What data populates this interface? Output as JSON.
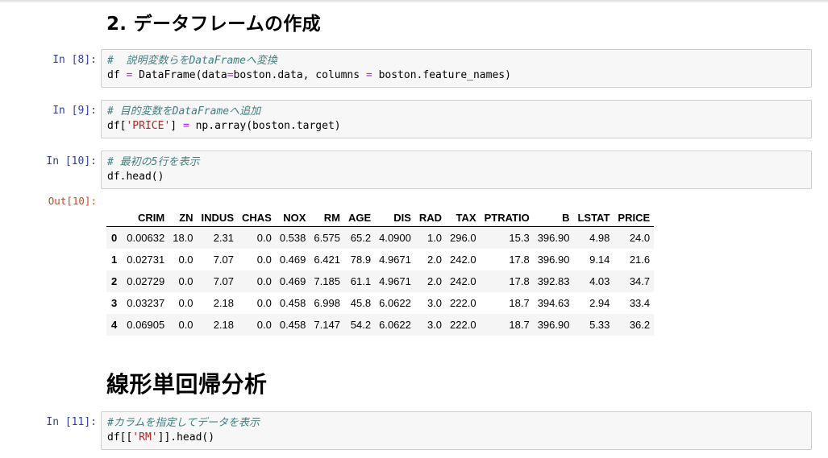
{
  "section_titles": {
    "create_dataframe": "2. データフレームの作成",
    "linear_regression": "線形単回帰分析"
  },
  "cells": [
    {
      "prompt": "In [8]:",
      "comment": "#  説明変数らをDataFrameへ変換",
      "code_a": "df ",
      "code_op": "=",
      "code_b": " DataFrame(data",
      "code_op2": "=",
      "code_c": "boston.data, columns ",
      "code_op3": "=",
      "code_d": " boston.feature_names)"
    },
    {
      "prompt": "In [9]:",
      "comment": "# 目的変数をDataFrameへ追加",
      "code_a": "df[",
      "code_str": "'PRICE'",
      "code_b": "] ",
      "code_op": "=",
      "code_c": " np.array(boston.target)"
    },
    {
      "prompt": "In [10]:",
      "comment": "# 最初の5行を表示",
      "code": "df.head()"
    },
    {
      "prompt": "In [11]:",
      "comment": "#カラムを指定してデータを表示",
      "code_a": "df[[",
      "code_str": "'RM'",
      "code_b": "]].head()"
    }
  ],
  "output": {
    "prompt": "Out[10]:",
    "columns": [
      "CRIM",
      "ZN",
      "INDUS",
      "CHAS",
      "NOX",
      "RM",
      "AGE",
      "DIS",
      "RAD",
      "TAX",
      "PTRATIO",
      "B",
      "LSTAT",
      "PRICE"
    ],
    "rows": [
      {
        "index": "0",
        "values": [
          "0.00632",
          "18.0",
          "2.31",
          "0.0",
          "0.538",
          "6.575",
          "65.2",
          "4.0900",
          "1.0",
          "296.0",
          "15.3",
          "396.90",
          "4.98",
          "24.0"
        ]
      },
      {
        "index": "1",
        "values": [
          "0.02731",
          "0.0",
          "7.07",
          "0.0",
          "0.469",
          "6.421",
          "78.9",
          "4.9671",
          "2.0",
          "242.0",
          "17.8",
          "396.90",
          "9.14",
          "21.6"
        ]
      },
      {
        "index": "2",
        "values": [
          "0.02729",
          "0.0",
          "7.07",
          "0.0",
          "0.469",
          "7.185",
          "61.1",
          "4.9671",
          "2.0",
          "242.0",
          "17.8",
          "392.83",
          "4.03",
          "34.7"
        ]
      },
      {
        "index": "3",
        "values": [
          "0.03237",
          "0.0",
          "2.18",
          "0.0",
          "0.458",
          "6.998",
          "45.8",
          "6.0622",
          "3.0",
          "222.0",
          "18.7",
          "394.63",
          "2.94",
          "33.4"
        ]
      },
      {
        "index": "4",
        "values": [
          "0.06905",
          "0.0",
          "2.18",
          "0.0",
          "0.458",
          "7.147",
          "54.2",
          "6.0622",
          "3.0",
          "222.0",
          "18.7",
          "396.90",
          "5.33",
          "36.2"
        ]
      }
    ]
  },
  "colors": {
    "prompt_in": "#303f9f",
    "prompt_out": "#d84315",
    "comment": "#408080",
    "operator": "#aa22ff",
    "string": "#ba2121",
    "cell_bg": "#f7f7f7"
  }
}
